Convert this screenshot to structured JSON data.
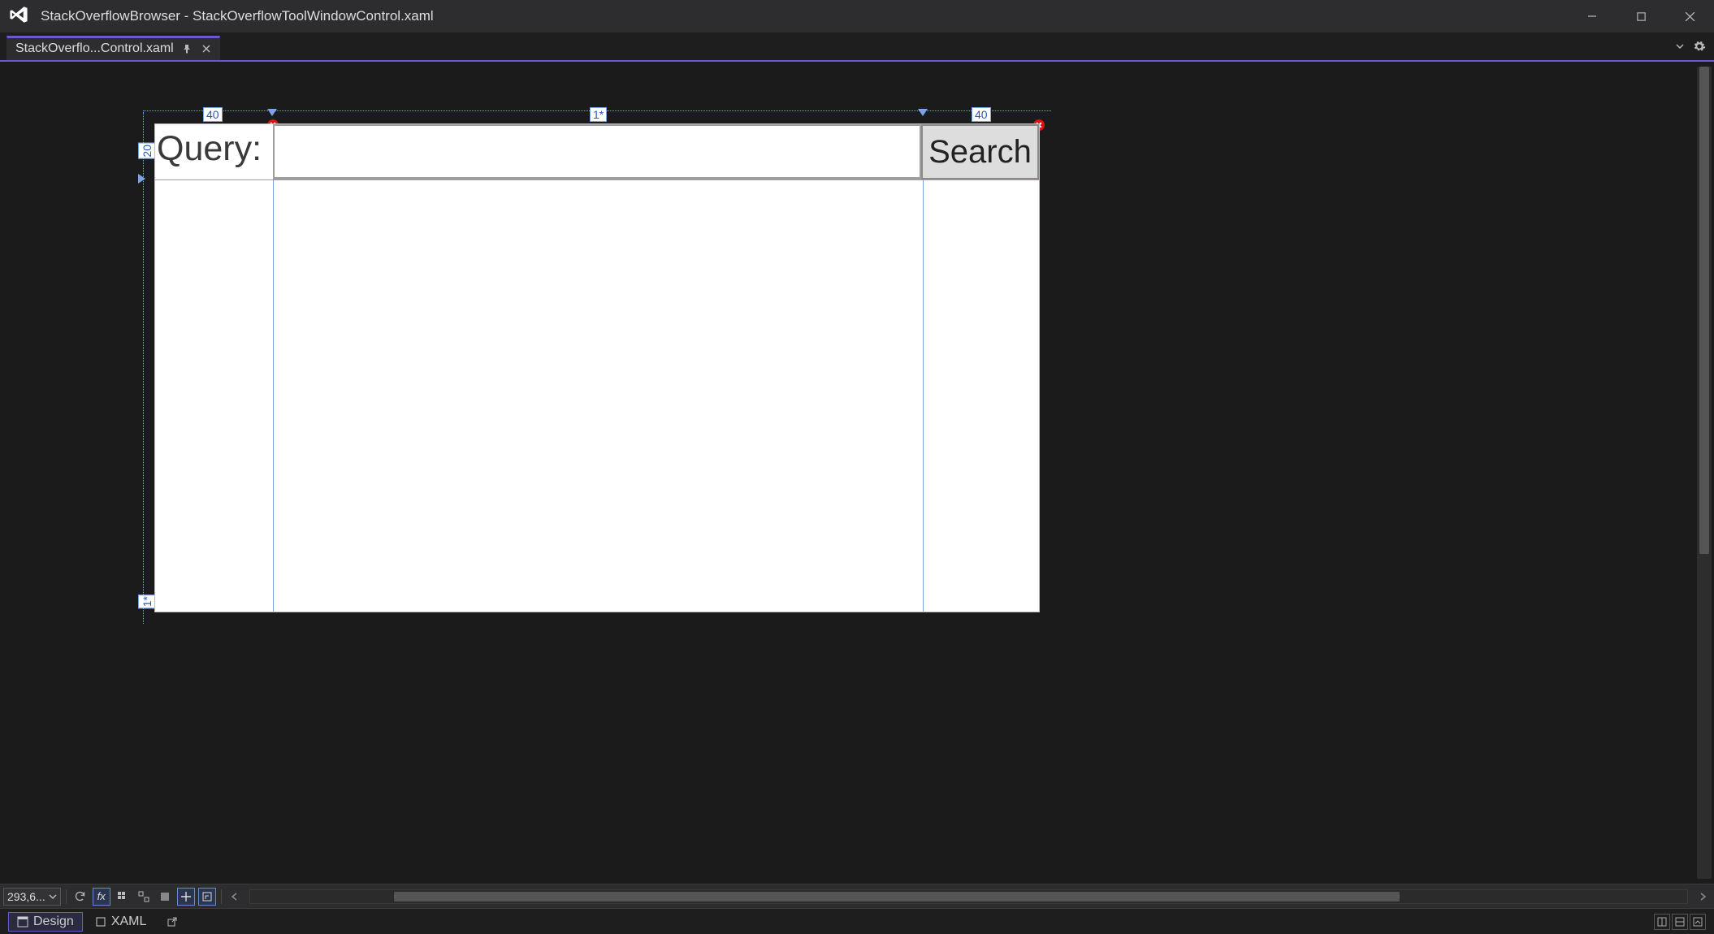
{
  "titlebar": {
    "app_icon": "visual-studio",
    "title": "StackOverflowBrowser - StackOverflowToolWindowControl.xaml"
  },
  "tabs": [
    {
      "label": "StackOverflo...Control.xaml",
      "pinned": true,
      "active": true
    }
  ],
  "designer": {
    "zoom_text": "293,6...",
    "columns": [
      {
        "width_label": "40",
        "locked": true
      },
      {
        "width_label": "1*",
        "locked": false
      },
      {
        "width_label": "40",
        "locked": true
      }
    ],
    "rows": [
      {
        "height_label": "20"
      },
      {
        "height_label": "1*"
      }
    ],
    "content": {
      "query_label": "Query:",
      "search_button": "Search",
      "textbox_value": ""
    }
  },
  "pane_switcher": {
    "design_label": "Design",
    "xaml_label": "XAML"
  }
}
